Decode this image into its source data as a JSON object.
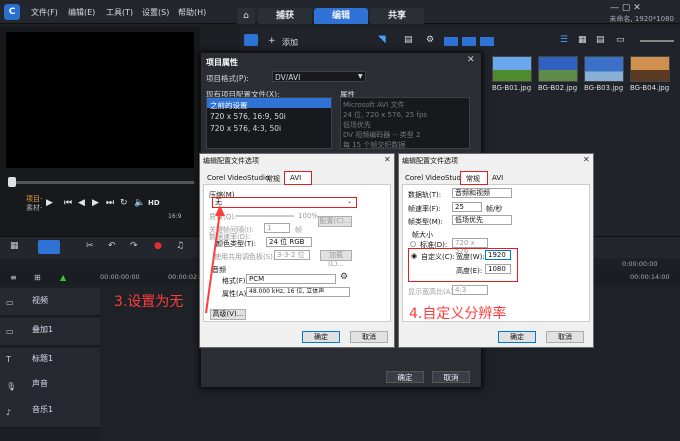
{
  "app": {
    "logo": "C",
    "menu": [
      "文件(F)",
      "编辑(E)",
      "工具(T)",
      "设置(S)",
      "帮助(H)"
    ],
    "tabs": [
      "捕获",
      "编辑",
      "共享"
    ],
    "home_icon": "home-icon",
    "project_info": "未命名, 1920*1080"
  },
  "preview": {
    "project_label": "项目-",
    "clip_label": "素材-",
    "time": "00:00:00:00",
    "hd": "HD",
    "aspect": "16:9"
  },
  "library": {
    "add_label": "添加",
    "thumbs": [
      "BG-B01.jpg",
      "BG-B02.jpg",
      "BG-B03.jpg",
      "BG-B04.jpg"
    ],
    "thumb_colors": [
      "#3f7fd8",
      "#4a88d8",
      "#3e7bcf",
      "#c07a3a"
    ]
  },
  "timeline": {
    "tracks": [
      "视频",
      "叠加1",
      "标题1",
      "声音",
      "音乐1"
    ],
    "ruler": [
      "00:00:00:00",
      "00:00:02:00",
      "00:00:14:00"
    ],
    "time_right": "0:00:00:00"
  },
  "project_dialog": {
    "title": "项目属性",
    "format_label": "项目格式(P):",
    "format_value": "DV/AVI",
    "profiles_label": "现有项目配置文件(X):",
    "profiles": [
      "之前的设置",
      "720 x 576, 16:9, 50i",
      "720 x 576, 4:3, 50i"
    ],
    "properties_label": "属性",
    "properties": [
      "Microsoft AVI 文件",
      "24 位, 720 x 576, 25 fps",
      "低场优先",
      "DV 视频编码器 -- 类型 2",
      "每 15 个帧交织数据"
    ],
    "ok": "确定",
    "cancel": "取消"
  },
  "avi_dialog": {
    "title": "编辑配置文件选项",
    "tabs": [
      "Corel VideoStudio",
      "常规",
      "AVI"
    ],
    "compression_label": "压缩(M)",
    "compression_value": "无",
    "quality_label": "质量(Q):",
    "quality_value": "100%",
    "keyframe_label": "关键帧间隔(I):",
    "keyframe_value": "1",
    "keyframe_unit": "帧",
    "config_button": "配置(C)...",
    "datarate_label": "数据速率(D):",
    "colortype_label": "颜色类型(T):",
    "colortype_value": "24 位 RGB",
    "shared_palette_label": "使用共用调色板(S):",
    "palette_value": "3-3-2 位",
    "palette_button": "加载(L)...",
    "audio_label": "音频",
    "audio_format_label": "格式(F):",
    "audio_format_value": "PCM",
    "audio_attr_label": "属性(A):",
    "audio_attr_value": "48.000 kHz, 16 位, 立体声",
    "advanced_button": "高级(V)...",
    "ok": "确定",
    "cancel": "取消"
  },
  "general_dialog": {
    "title": "编辑配置文件选项",
    "tabs": [
      "Corel VideoStudio",
      "常规",
      "AVI"
    ],
    "datatrack_label": "数据轨(T):",
    "datatrack_value": "音频和视频",
    "framerate_label": "帧速率(F):",
    "framerate_value": "25",
    "framerate_unit": "帧/秒",
    "frametype_label": "帧类型(M):",
    "frametype_value": "低场优先",
    "framesize_label": "帧大小",
    "standard_label": "标准(D):",
    "standard_value": "720 x 576",
    "custom_label": "自定义(C):",
    "width_label": "宽度(W):",
    "width_value": "1920",
    "height_label": "高度(E):",
    "height_value": "1080",
    "aspect_label": "显示宽高比(A):",
    "aspect_value": "4:3",
    "ok": "确定",
    "cancel": "取消"
  },
  "annotations": {
    "step3": "3.设置为无",
    "step4": "4.自定义分辨率"
  },
  "colors": {
    "accent": "#2f73d6",
    "annotation": "#ff3d3d"
  }
}
